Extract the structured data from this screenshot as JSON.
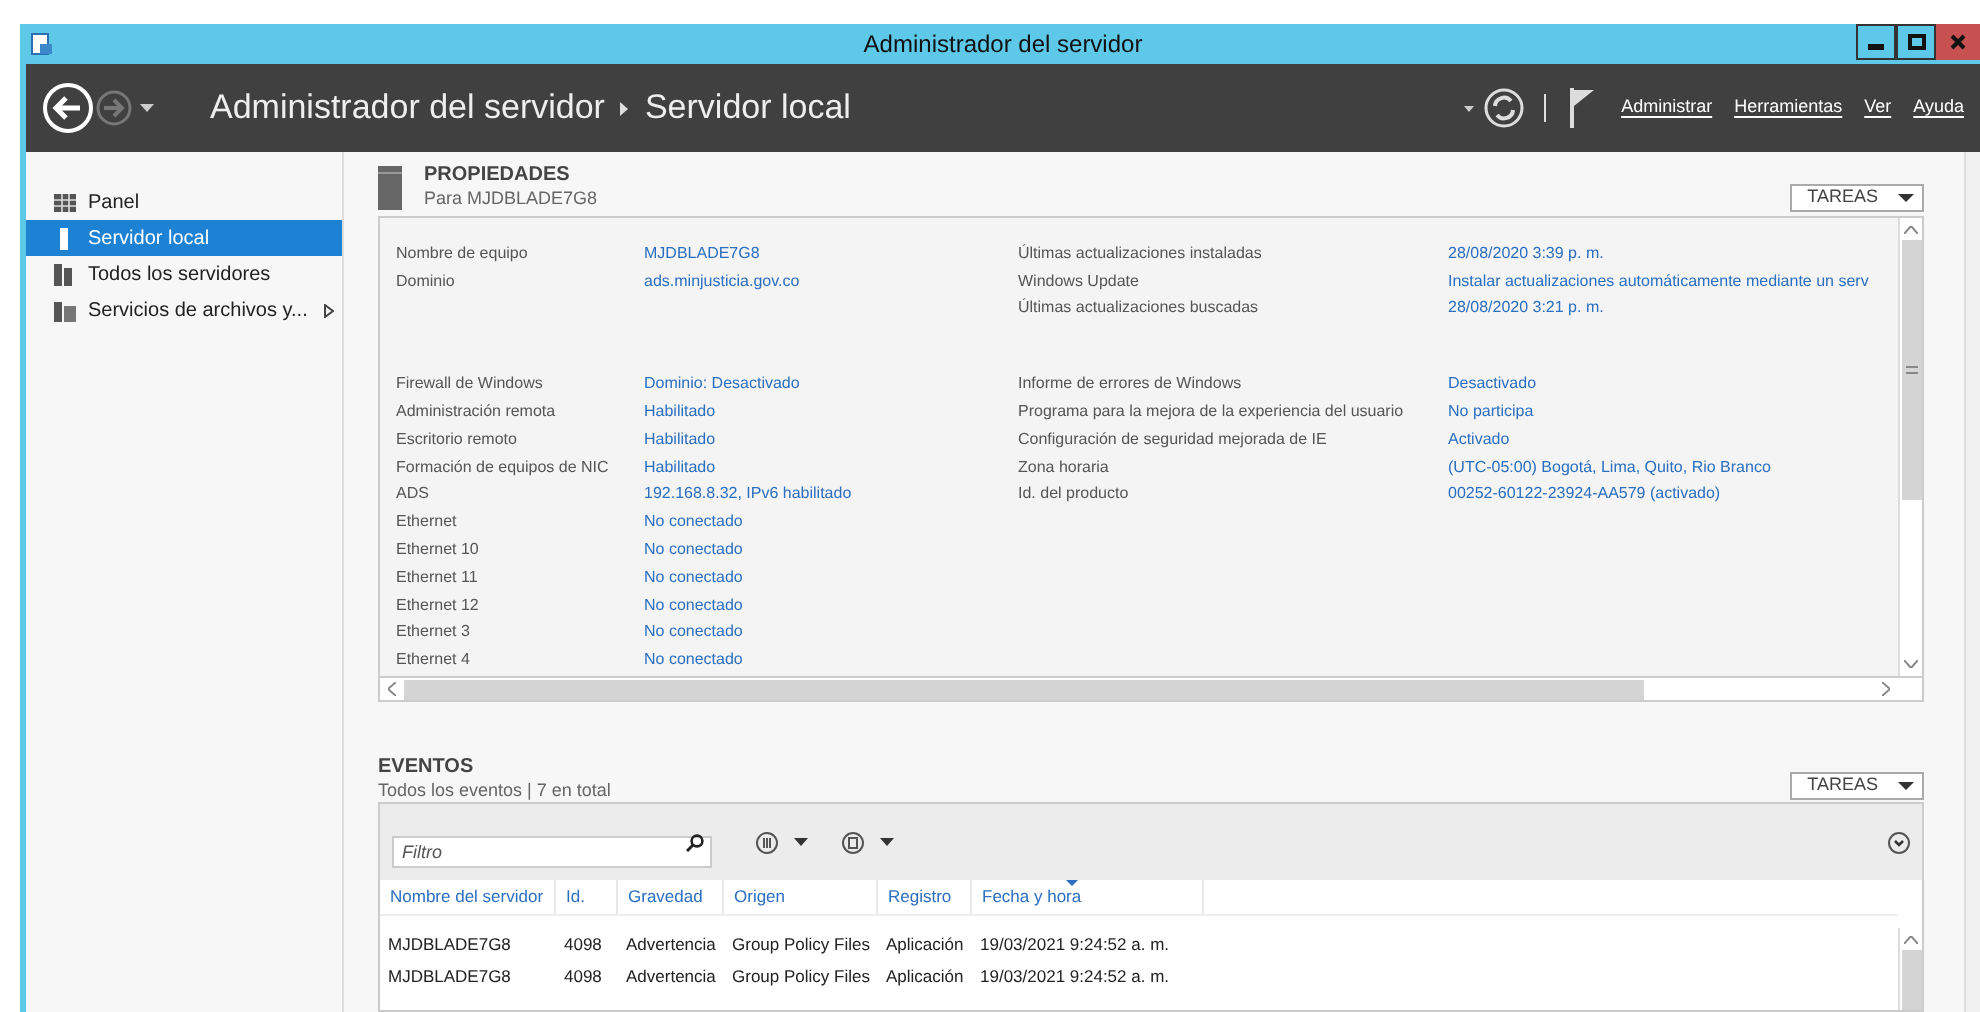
{
  "window": {
    "title": "Administrador del servidor"
  },
  "header": {
    "breadcrumb": [
      "Administrador del servidor",
      "Servidor local"
    ],
    "menu": [
      "Administrar",
      "Herramientas",
      "Ver",
      "Ayuda"
    ]
  },
  "sidebar": {
    "items": [
      {
        "label": "Panel",
        "selected": false,
        "kind": "dashboard"
      },
      {
        "label": "Servidor local",
        "selected": true,
        "kind": "server"
      },
      {
        "label": "Todos los servidores",
        "selected": false,
        "kind": "servers"
      },
      {
        "label": "Servicios de archivos y...",
        "selected": false,
        "kind": "files",
        "expandable": true
      }
    ]
  },
  "properties": {
    "title": "PROPIEDADES",
    "subtitle": "Para MJDBLADE7G8",
    "tasks_label": "TAREAS",
    "groups": [
      {
        "left": [
          {
            "label": "Nombre de equipo",
            "value": "MJDBLADE7G8"
          },
          {
            "label": "Dominio",
            "value": "ads.minjusticia.gov.co"
          }
        ],
        "right": [
          {
            "label": "Últimas actualizaciones instaladas",
            "value": "28/08/2020 3:39 p. m."
          },
          {
            "label": "Windows Update",
            "value": "Instalar actualizaciones automáticamente mediante un serv"
          },
          {
            "label": "Últimas actualizaciones buscadas",
            "value": "28/08/2020 3:21 p. m."
          }
        ]
      },
      {
        "left": [
          {
            "label": "Firewall de Windows",
            "value": "Dominio: Desactivado"
          },
          {
            "label": "Administración remota",
            "value": "Habilitado"
          },
          {
            "label": "Escritorio remoto",
            "value": "Habilitado"
          },
          {
            "label": "Formación de equipos de NIC",
            "value": "Habilitado"
          },
          {
            "label": "ADS",
            "value": "192.168.8.32, IPv6 habilitado"
          },
          {
            "label": "Ethernet",
            "value": "No conectado"
          },
          {
            "label": "Ethernet 10",
            "value": "No conectado"
          },
          {
            "label": "Ethernet 11",
            "value": "No conectado"
          },
          {
            "label": "Ethernet 12",
            "value": "No conectado"
          },
          {
            "label": "Ethernet 3",
            "value": "No conectado"
          },
          {
            "label": "Ethernet 4",
            "value": "No conectado"
          }
        ],
        "right": [
          {
            "label": "Informe de errores de Windows",
            "value": "Desactivado"
          },
          {
            "label": "Programa para la mejora de la experiencia del usuario",
            "value": "No participa"
          },
          {
            "label": "Configuración de seguridad mejorada de IE",
            "value": "Activado"
          },
          {
            "label": "Zona horaria",
            "value": "(UTC-05:00) Bogotá, Lima, Quito, Rio Branco"
          },
          {
            "label": "Id. del producto",
            "value": "00252-60122-23924-AA579 (activado)"
          }
        ]
      }
    ]
  },
  "events": {
    "title": "EVENTOS",
    "subtitle": "Todos los eventos | 7 en total",
    "tasks_label": "TAREAS",
    "filter": {
      "placeholder": "Filtro"
    },
    "columns": [
      {
        "label": "Nombre del servidor",
        "sorted": false
      },
      {
        "label": "Id.",
        "sorted": false
      },
      {
        "label": "Gravedad",
        "sorted": false
      },
      {
        "label": "Origen",
        "sorted": false
      },
      {
        "label": "Registro",
        "sorted": false
      },
      {
        "label": "Fecha y hora",
        "sorted": true
      }
    ],
    "rows": [
      [
        "MJDBLADE7G8",
        "4098",
        "Advertencia",
        "Group Policy Files",
        "Aplicación",
        "19/03/2021 9:24:52 a. m."
      ],
      [
        "MJDBLADE7G8",
        "4098",
        "Advertencia",
        "Group Policy Files",
        "Aplicación",
        "19/03/2021 9:24:52 a. m."
      ]
    ]
  }
}
